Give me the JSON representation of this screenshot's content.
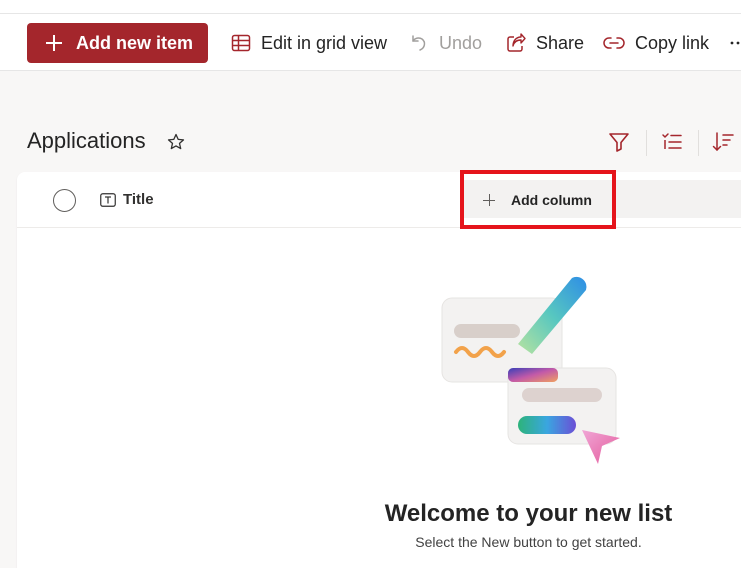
{
  "commandbar": {
    "new_item_label": "Add new item",
    "edit_grid_label": "Edit in grid view",
    "undo_label": "Undo",
    "share_label": "Share",
    "copy_link_label": "Copy link",
    "more_icon": "more-icon"
  },
  "list": {
    "title": "Applications",
    "favorite_icon": "star-icon"
  },
  "view_toolbar": {
    "icons": [
      "filter-icon",
      "group-icon",
      "sort-icon"
    ]
  },
  "columns": {
    "title_label": "Title",
    "add_column_label": "Add column"
  },
  "empty_state": {
    "title": "Welcome to your new list",
    "subtitle": "Select the New button to get started."
  },
  "colors": {
    "accent": "#a4262c",
    "highlight": "#e5141b",
    "filter_icon": "#a4262c"
  }
}
